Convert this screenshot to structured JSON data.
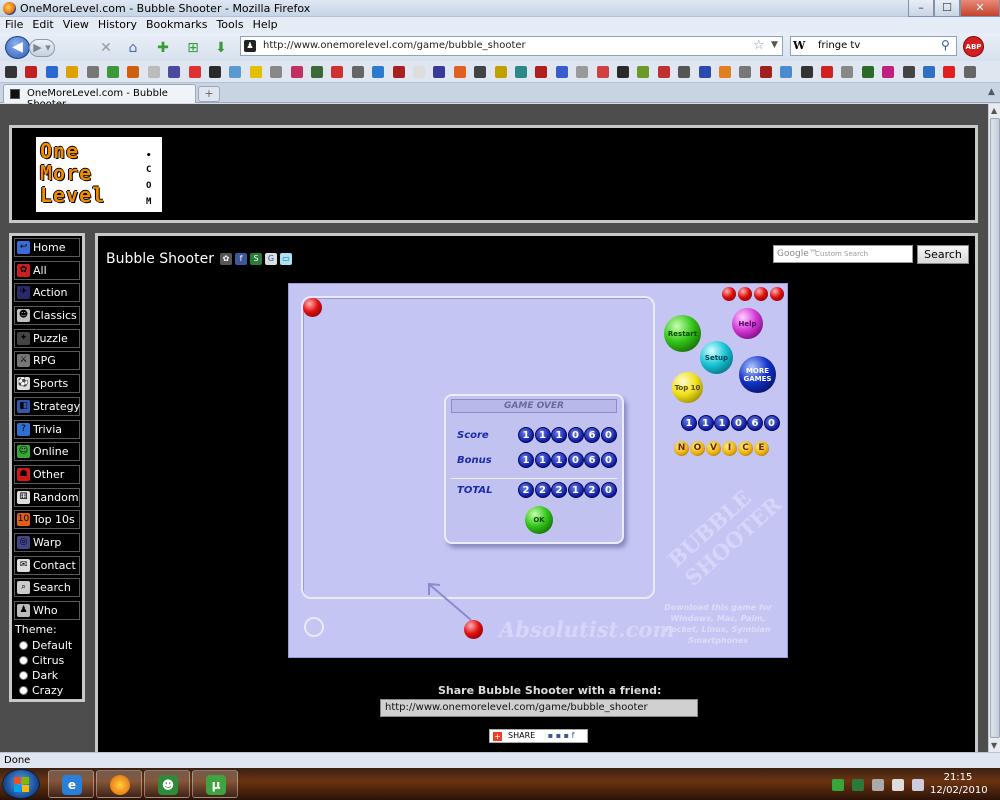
{
  "window": {
    "title": "OneMoreLevel.com - Bubble Shooter - Mozilla Firefox",
    "min_glyph": "–",
    "max_glyph": "☐",
    "close_glyph": "✕"
  },
  "menu": [
    "File",
    "Edit",
    "View",
    "History",
    "Bookmarks",
    "Tools",
    "Help"
  ],
  "nav": {
    "url": "http://www.onemorelevel.com/game/bubble_shooter",
    "search_engine_glyph": "W",
    "search_value": "fringe tv",
    "abp_label": "ABP"
  },
  "tab": {
    "label": "OneMoreLevel.com - Bubble Shooter",
    "new_tab_glyph": "+"
  },
  "site": {
    "logo_lines": [
      "One",
      "More",
      "Level"
    ],
    "logo_suffix": [
      "•",
      "C",
      "O",
      "M"
    ],
    "sidebar": [
      {
        "label": "Home",
        "icon": "home-icon",
        "color": "#3b6bd6",
        "glyph": "↩"
      },
      {
        "label": "All",
        "icon": "cherry-icon",
        "color": "#c82020",
        "glyph": "✿"
      },
      {
        "label": "Action",
        "icon": "action-icon",
        "color": "#2a2a6a",
        "glyph": "✈"
      },
      {
        "label": "Classics",
        "icon": "classics-icon",
        "color": "#c0c0c0",
        "glyph": "☻"
      },
      {
        "label": "Puzzle",
        "icon": "puzzle-icon",
        "color": "#444444",
        "glyph": "✦"
      },
      {
        "label": "RPG",
        "icon": "swords-icon",
        "color": "#777777",
        "glyph": "⚔"
      },
      {
        "label": "Sports",
        "icon": "ball-icon",
        "color": "#dddddd",
        "glyph": "⚽"
      },
      {
        "label": "Strategy",
        "icon": "strategy-icon",
        "color": "#3355aa",
        "glyph": "◧"
      },
      {
        "label": "Trivia",
        "icon": "question-icon",
        "color": "#2f6fd0",
        "glyph": "?"
      },
      {
        "label": "Online",
        "icon": "online-icon",
        "color": "#3aa63a",
        "glyph": "☺"
      },
      {
        "label": "Other",
        "icon": "ghost-icon",
        "color": "#d01818",
        "glyph": "☗"
      },
      {
        "label": "Random",
        "icon": "dice-icon",
        "color": "#dddddd",
        "glyph": "⚅"
      },
      {
        "label": "Top 10s",
        "icon": "top10-icon",
        "color": "#e06010",
        "glyph": "10"
      },
      {
        "label": "Warp",
        "icon": "warp-icon",
        "color": "#444488",
        "glyph": "◎"
      },
      {
        "label": "Contact",
        "icon": "mail-icon",
        "color": "#dddddd",
        "glyph": "✉"
      },
      {
        "label": "Search",
        "icon": "search-icon",
        "color": "#cccccc",
        "glyph": "⌕"
      },
      {
        "label": "Who",
        "icon": "person-icon",
        "color": "#bbbbbb",
        "glyph": "♟"
      }
    ],
    "theme": {
      "heading": "Theme:",
      "options": [
        "Default",
        "Citrus",
        "Dark",
        "Crazy"
      ]
    }
  },
  "main": {
    "game_title": "Bubble Shooter",
    "search_brand": "Google™",
    "search_placeholder": "Custom Search",
    "search_button": "Search",
    "share_heading": "Share Bubble Shooter with a friend:",
    "share_url": "http://www.onemorelevel.com/game/bubble_shooter",
    "addthis_label": "SHARE"
  },
  "game": {
    "buttons": {
      "restart": "Restart",
      "help": "Help",
      "setup": "Setup",
      "more_games": "MORE GAMES",
      "top10": "Top 10"
    },
    "score_display": "111060",
    "level": "NOVICE",
    "dialog": {
      "title": "GAME OVER",
      "score_label": "Score",
      "score": "111060",
      "bonus_label": "Bonus",
      "bonus": "111060",
      "total_label": "TOTAL",
      "total": "222120",
      "ok": "OK"
    },
    "watermark_brand": "Absolutist.com",
    "watermark_logo": "BUBBLE SHOOTER",
    "promo": "Download this game for Windows, Mac, Palm, Pocket, Linux, Symbian Smartphones"
  },
  "status": {
    "text": "Done"
  },
  "taskbar": {
    "time": "21:15",
    "date": "12/02/2010"
  }
}
